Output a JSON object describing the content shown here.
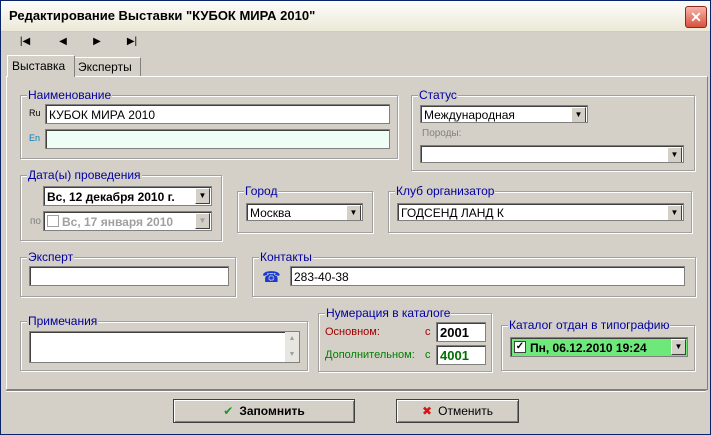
{
  "window": {
    "title": "Редактирование Выставки \"КУБОК МИРА 2010\"",
    "close": "✕"
  },
  "nav": {
    "first": "|◀",
    "prev": "◀",
    "next": "▶",
    "last": "▶|"
  },
  "tabs": [
    {
      "label": "Выставка"
    },
    {
      "label": "Эксперты"
    }
  ],
  "name_group": {
    "legend": "Наименование",
    "ru_label": "Ru",
    "ru_value": "КУБОК МИРА 2010",
    "en_label": "En",
    "en_value": ""
  },
  "status_group": {
    "legend": "Статус",
    "status_value": "Международная",
    "breeds_label": "Породы:",
    "breeds_value": ""
  },
  "dates_group": {
    "legend": "Дата(ы) проведения",
    "date_from": "Вс, 12 декабря 2010 г.",
    "to_label": "по",
    "date_to": "Вс, 17   января   2010"
  },
  "city_group": {
    "legend": "Город",
    "value": "Москва"
  },
  "club_group": {
    "legend": "Клуб организатор",
    "value": "ГОДСЕНД ЛАНД К"
  },
  "expert_group": {
    "legend": "Эксперт",
    "value": ""
  },
  "contacts_group": {
    "legend": "Контакты",
    "value": "283-40-38"
  },
  "notes_group": {
    "legend": "Примечания",
    "value": ""
  },
  "catalog_group": {
    "legend": "Нумерация в каталоге",
    "main_label": "Основном:",
    "main_prefix": "с",
    "main_value": "2001",
    "extra_label": "Дополнительном:",
    "extra_prefix": "с",
    "extra_value": "4001"
  },
  "print_group": {
    "legend": "Каталог отдан в типографию",
    "checkmark": "✓",
    "value": "Пн, 06.12.2010  19:24"
  },
  "buttons": {
    "save": "Запомнить",
    "save_icon": "✔",
    "cancel": "Отменить",
    "cancel_icon": "✖"
  },
  "colors": {
    "accent_text": "#0000a0",
    "en_field_bg": "#eefdf5",
    "print_field_bg": "#6fe87a",
    "save_icon": "#1a9a1a",
    "cancel_icon": "#d01818"
  }
}
